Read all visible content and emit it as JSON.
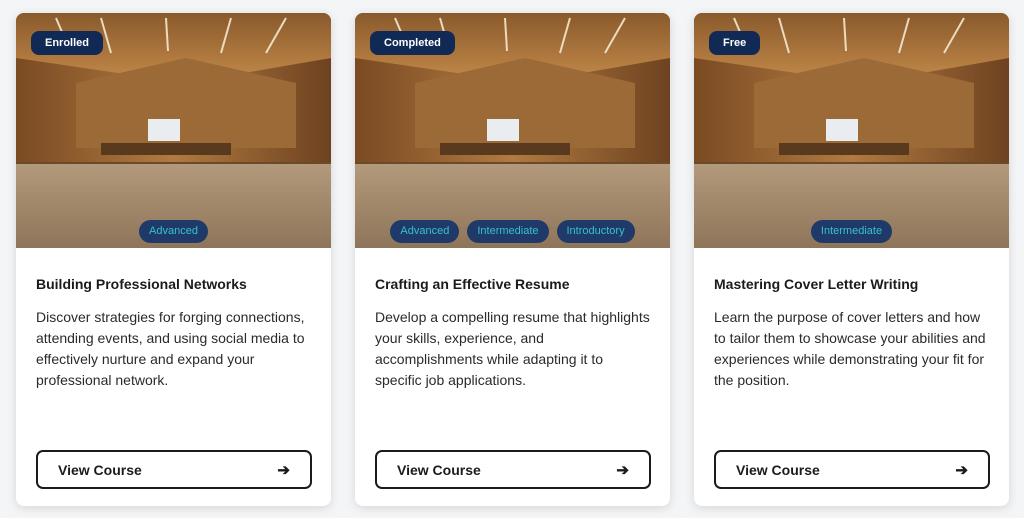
{
  "courses": [
    {
      "status": "Enrolled",
      "levels": [
        "Advanced"
      ],
      "title": "Building Professional Networks",
      "description": "Discover strategies for forging connections, attending events, and using social media to effectively nurture and expand your professional network.",
      "button_label": "View Course"
    },
    {
      "status": "Completed",
      "levels": [
        "Advanced",
        "Intermediate",
        "Introductory"
      ],
      "title": "Crafting an Effective Resume",
      "description": "Develop a compelling resume that highlights your skills, experience, and accomplishments while adapting it to specific job applications.",
      "button_label": "View Course"
    },
    {
      "status": "Free",
      "levels": [
        "Intermediate"
      ],
      "title": "Mastering Cover Letter Writing",
      "description": "Learn the purpose of cover letters and how to tailor them to showcase your abilities and experiences while demonstrating your fit for the position.",
      "button_label": "View Course"
    }
  ],
  "icons": {
    "button_arrow": "arrow-right-icon"
  },
  "colors": {
    "status_badge_bg": "#112a55",
    "level_badge_bg": "#1f3a68",
    "level_badge_text": "#36c2c8",
    "button_border": "#1b1b1b"
  }
}
